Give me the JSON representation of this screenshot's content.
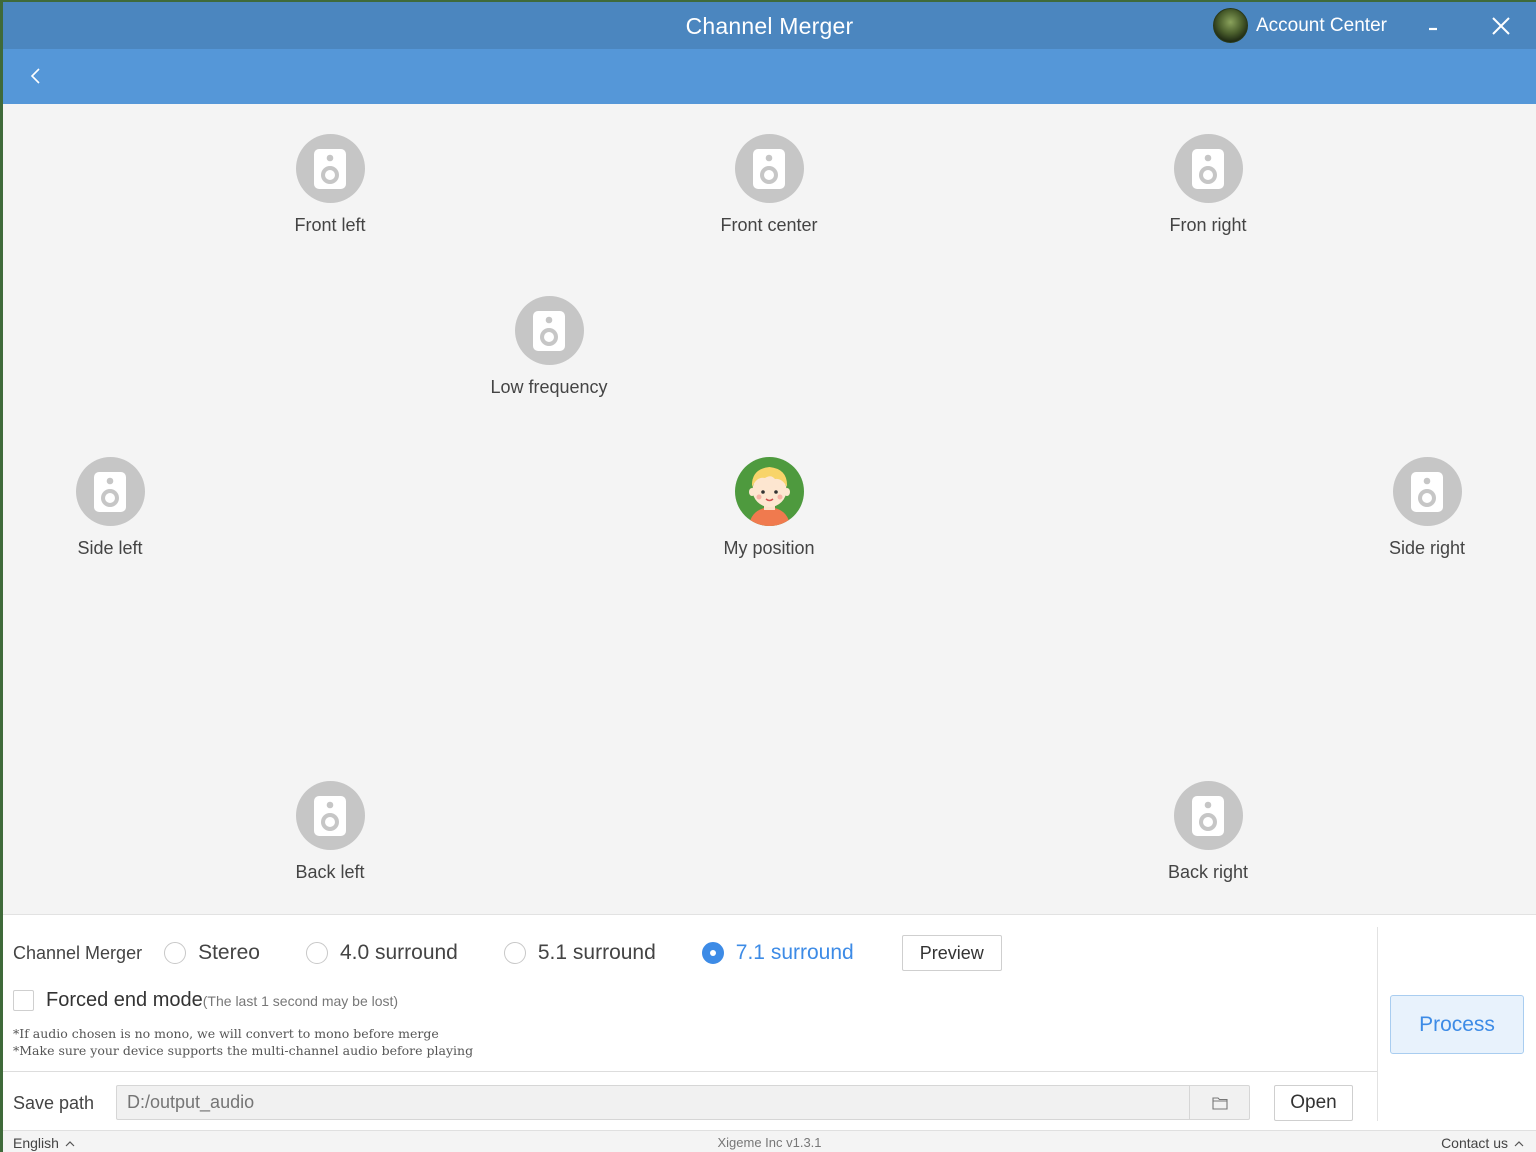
{
  "window": {
    "title": "Channel Merger",
    "account_label": "Account Center"
  },
  "speakers": {
    "front_left": "Front left",
    "front_center": "Front center",
    "front_right": "Fron right",
    "low_frequency": "Low frequency",
    "side_left": "Side left",
    "my_position": "My position",
    "side_right": "Side right",
    "back_left": "Back left",
    "back_right": "Back right"
  },
  "options": {
    "title": "Channel Merger",
    "modes": [
      "Stereo",
      "4.0 surround",
      "5.1 surround",
      "7.1 surround"
    ],
    "selected": "7.1 surround",
    "preview_label": "Preview"
  },
  "forced": {
    "label": "Forced end mode",
    "note": "(The last 1 second may be lost)",
    "checked": false
  },
  "notes": [
    "*If audio chosen is no mono, we will convert to mono before merge",
    "*Make sure your device supports the multi-channel audio before playing"
  ],
  "save": {
    "label": "Save path",
    "placeholder": "D:/output_audio",
    "open_label": "Open"
  },
  "process_label": "Process",
  "status": {
    "language": "English",
    "version": "Xigeme Inc v1.3.1",
    "contact": "Contact us"
  },
  "colors": {
    "titlebar": "#4b86bf",
    "subbar": "#5597d8",
    "accent": "#3d8be6",
    "speaker": "#c6c6c6",
    "me": "#4e9a3e"
  },
  "icons": {
    "speaker": "speaker-icon",
    "me": "kid-avatar-icon",
    "back": "chevron-left-icon",
    "folder": "folder-icon"
  }
}
